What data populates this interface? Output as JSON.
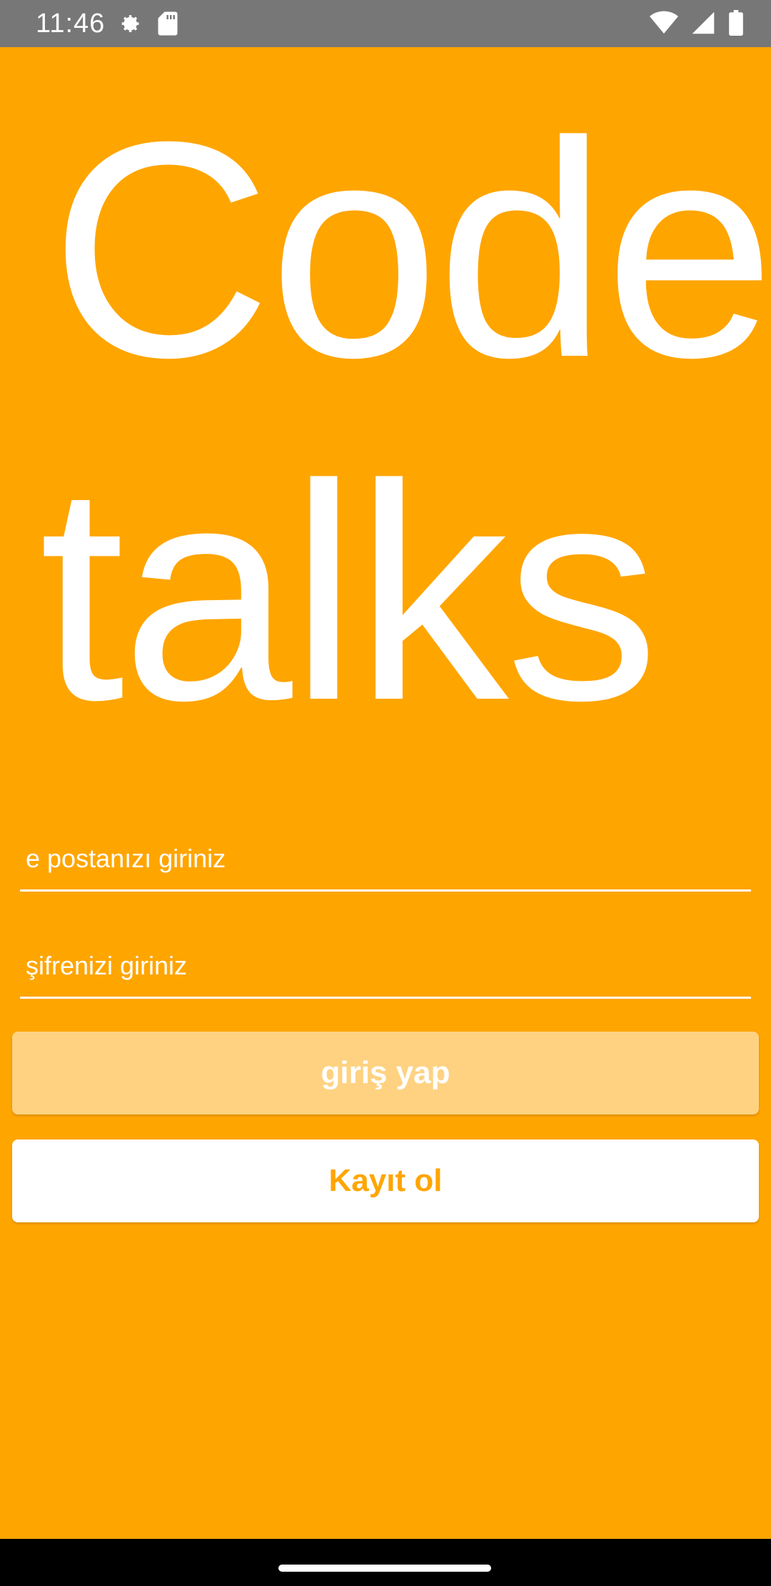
{
  "status_bar": {
    "time": "11:46",
    "left_icons": [
      "settings-gear-icon",
      "sd-card-icon"
    ],
    "right_icons": [
      "wifi-icon",
      "cell-signal-icon",
      "battery-icon"
    ]
  },
  "logo": {
    "line1": "Code",
    "line2": "talks"
  },
  "form": {
    "email_placeholder": "e postanızı giriniz",
    "email_value": "",
    "password_placeholder": "şifrenizi giriniz",
    "password_value": ""
  },
  "buttons": {
    "login_label": "giriş yap",
    "register_label": "Kayıt ol"
  },
  "colors": {
    "background": "#FFA500",
    "login_button": "#FED281",
    "register_text": "#FFA500",
    "status_bar": "#777777"
  }
}
